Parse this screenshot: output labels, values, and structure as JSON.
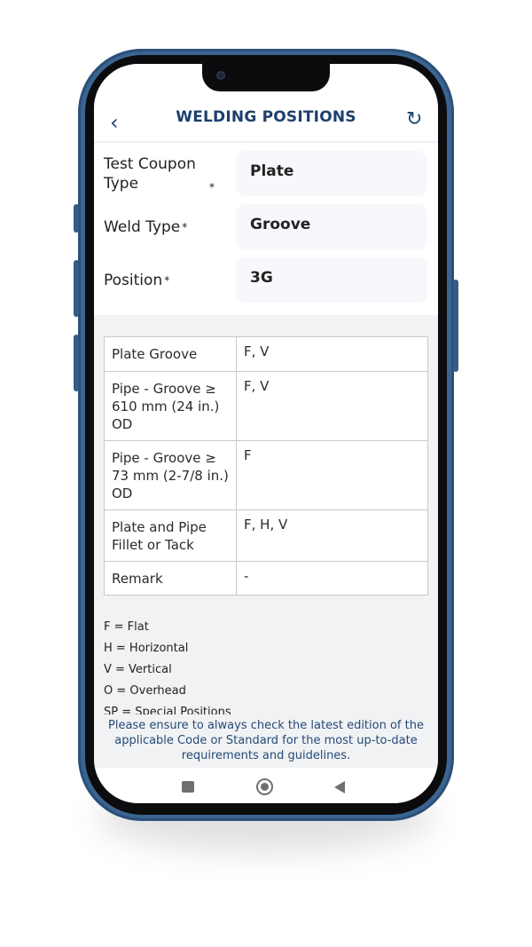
{
  "header": {
    "title": "WELDING POSITIONS",
    "back_icon": "chevron-left-icon",
    "refresh_icon": "refresh-icon"
  },
  "form": {
    "fields": [
      {
        "label": "Test Coupon Type",
        "required": "*",
        "value": "Plate"
      },
      {
        "label": "Weld Type",
        "required": "*",
        "value": "Groove"
      },
      {
        "label": "Position",
        "required": "*",
        "value": "3G"
      }
    ]
  },
  "table": {
    "rows": [
      {
        "label": "Plate Groove",
        "value": "F, V"
      },
      {
        "label": "Pipe - Groove ≥ 610 mm (24 in.) OD",
        "value": "F, V"
      },
      {
        "label": "Pipe - Groove ≥ 73 mm (2-7/8 in.) OD",
        "value": "F"
      },
      {
        "label": "Plate and Pipe Fillet or Tack",
        "value": "F, H, V"
      },
      {
        "label": "Remark",
        "value": "-"
      }
    ]
  },
  "legend": [
    "F = Flat",
    "H = Horizontal",
    "V = Vertical",
    "O = Overhead",
    "SP = Special Positions"
  ],
  "note": "Please ensure to always check the latest edition of the applicable Code or Standard for the most up-to-date requirements and guidelines.",
  "colors": {
    "accent": "#1c3f6e",
    "frame": "#3a6591"
  }
}
